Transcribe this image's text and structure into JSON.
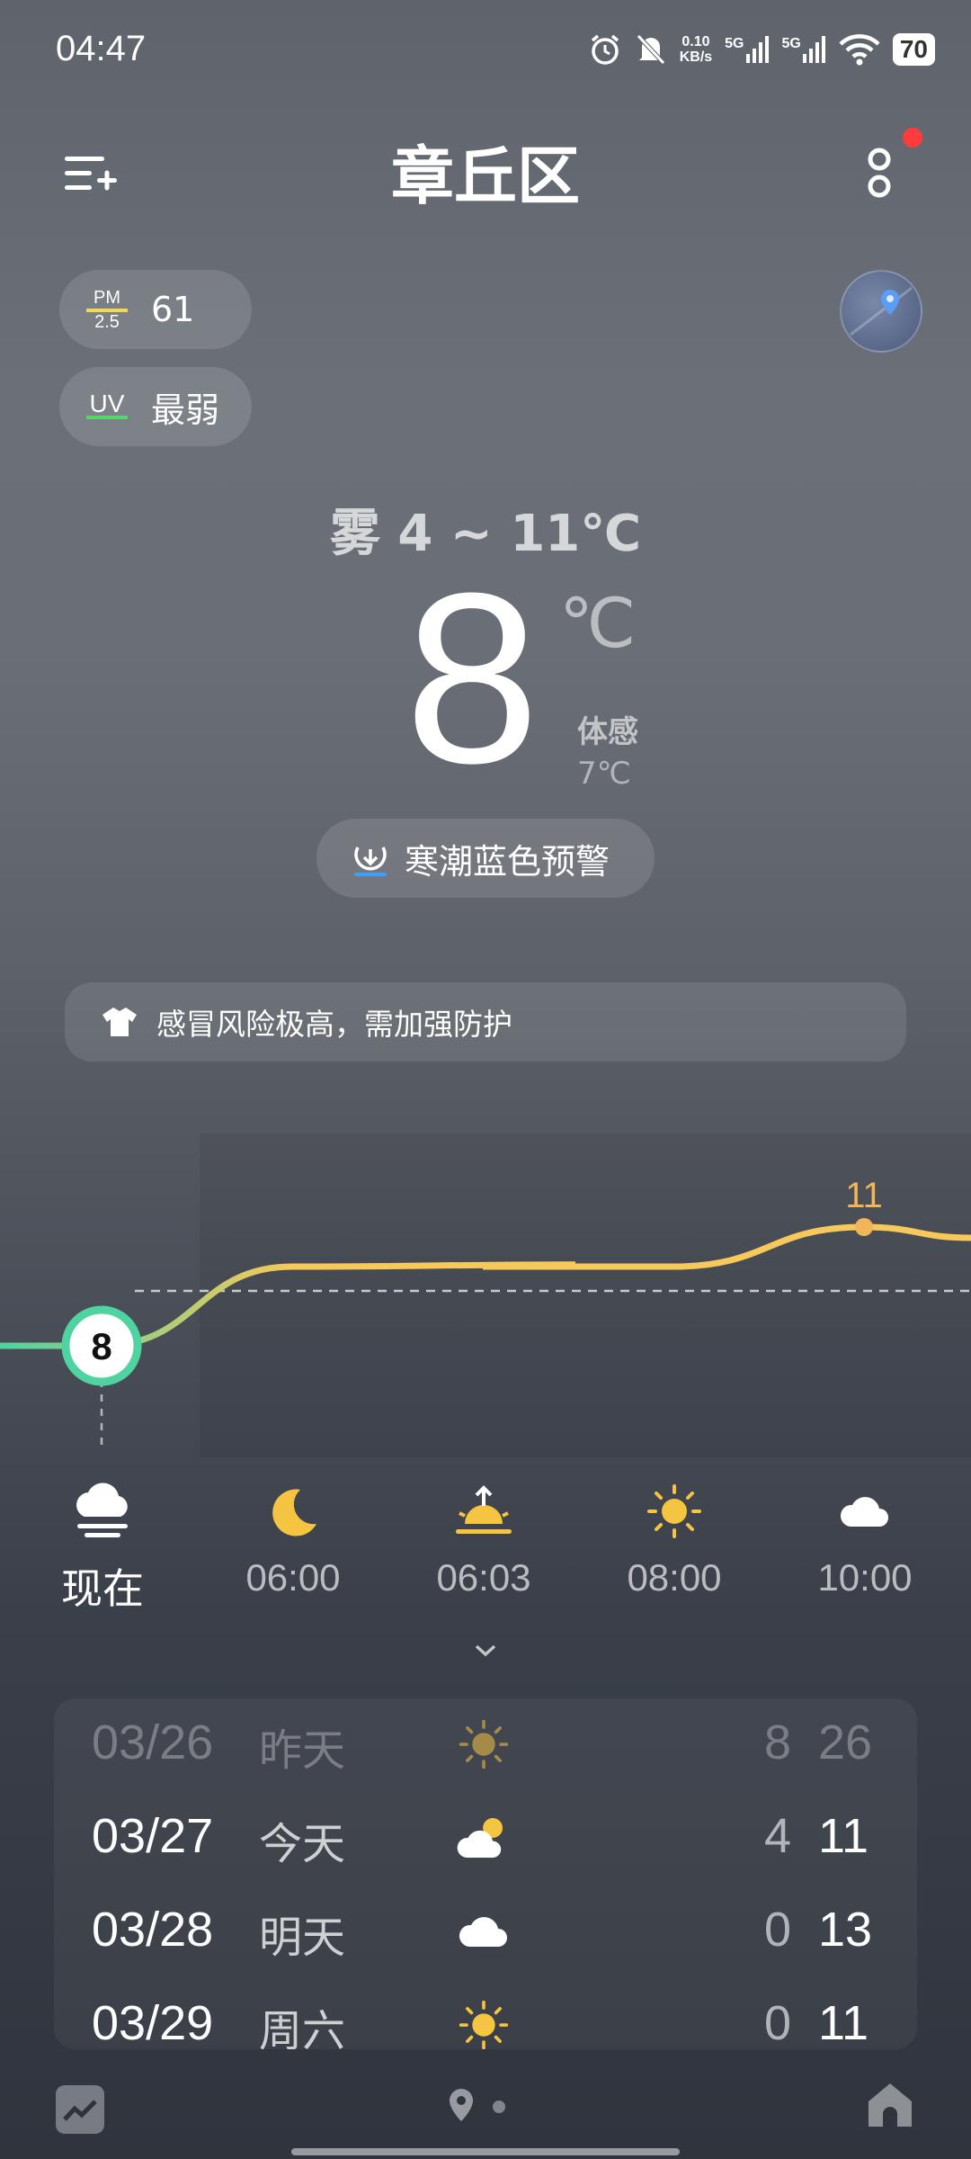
{
  "status_bar": {
    "time": "04:47",
    "net_speed_value": "0.10",
    "net_speed_unit": "KB/s",
    "sim1": "5G",
    "sim2": "5G",
    "battery": "70"
  },
  "header": {
    "title": "章丘区"
  },
  "pills": {
    "pm_label_top": "PM",
    "pm_label_bottom": "2.5",
    "pm_value": "61",
    "uv_label": "UV",
    "uv_value": "最弱"
  },
  "current": {
    "condition": "雾  4 ~ 11℃",
    "temp": "8",
    "unit": "℃",
    "feels_label": "体感",
    "feels_value": "7℃"
  },
  "alert": {
    "text": "寒潮蓝色预警"
  },
  "advice": {
    "text": "感冒风险极高，需加强防护"
  },
  "chart_data": {
    "type": "line",
    "title": "",
    "x": [
      "现在",
      "06:00",
      "06:03",
      "08:00",
      "10:00"
    ],
    "series": [
      {
        "values": [
          8,
          10,
          10,
          10,
          11
        ]
      }
    ],
    "current_marker": "8",
    "max_label": "11",
    "colors": {
      "start": "#4fd3a0",
      "end": "#f7c85a",
      "accent": "#f2b55a"
    }
  },
  "hourly": [
    {
      "time": "现在",
      "icon": "fog-cloud-icon"
    },
    {
      "time": "06:00",
      "icon": "moon-icon"
    },
    {
      "time": "06:03",
      "icon": "sunrise-icon"
    },
    {
      "time": "08:00",
      "icon": "sun-icon"
    },
    {
      "time": "10:00",
      "icon": "cloud-icon"
    }
  ],
  "daily": [
    {
      "date": "03/26",
      "day": "昨天",
      "icon": "sun-icon",
      "low": "8",
      "high": "26"
    },
    {
      "date": "03/27",
      "day": "今天",
      "icon": "partly-cloudy-icon",
      "low": "4",
      "high": "11"
    },
    {
      "date": "03/28",
      "day": "明天",
      "icon": "cloud-icon",
      "low": "0",
      "high": "13"
    },
    {
      "date": "03/29",
      "day": "周六",
      "icon": "sun-icon",
      "low": "0",
      "high": "11"
    }
  ]
}
